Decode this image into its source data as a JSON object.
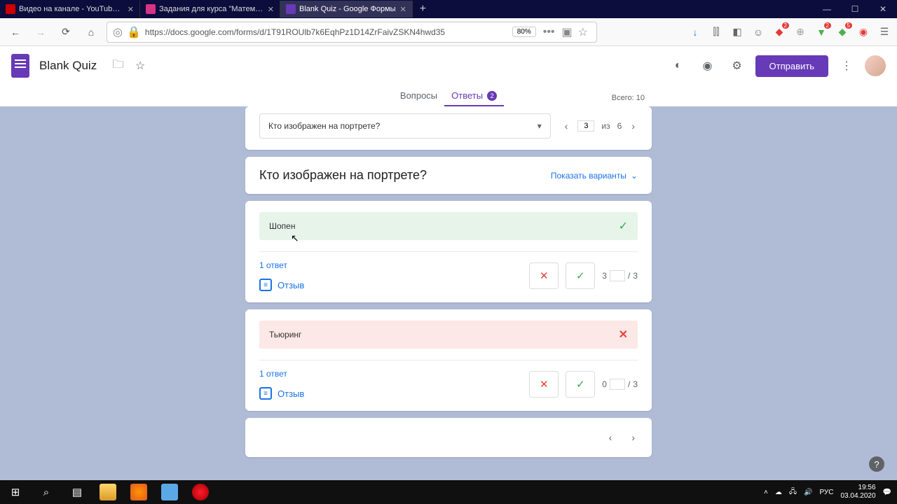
{
  "browser": {
    "tabs": [
      {
        "title": "Видео на канале - YouTube St"
      },
      {
        "title": "Задания для курса \"Математи"
      },
      {
        "title": "Blank Quiz - Google Формы"
      }
    ],
    "url": "https://docs.google.com/forms/d/1T91ROUlb7k6EqhPz1D14ZrFaivZSKN4hwd35",
    "zoom": "80%"
  },
  "forms": {
    "doc_title": "Blank Quiz",
    "send": "Отправить",
    "tab_questions": "Вопросы",
    "tab_responses": "Ответы",
    "responses_badge": "2",
    "total_label": "Всего: 10"
  },
  "selector": {
    "question": "Кто изображен на портрете?",
    "page_current": "3",
    "page_sep": "из",
    "page_total": "6"
  },
  "question": {
    "title": "Кто изображен на портрете?",
    "show_options": "Показать варианты"
  },
  "answers": [
    {
      "text": "Шопен",
      "status": "correct",
      "score": "3",
      "max": "3"
    },
    {
      "text": "Тьюринг",
      "status": "wrong",
      "score": "0",
      "max": "3"
    }
  ],
  "labels": {
    "one_response": "1 ответ",
    "feedback": "Отзыв"
  },
  "ext_badges": {
    "a": "2",
    "b": "2",
    "c": "5"
  },
  "taskbar": {
    "lang": "РУС",
    "time": "19:56",
    "date": "03.04.2020"
  }
}
